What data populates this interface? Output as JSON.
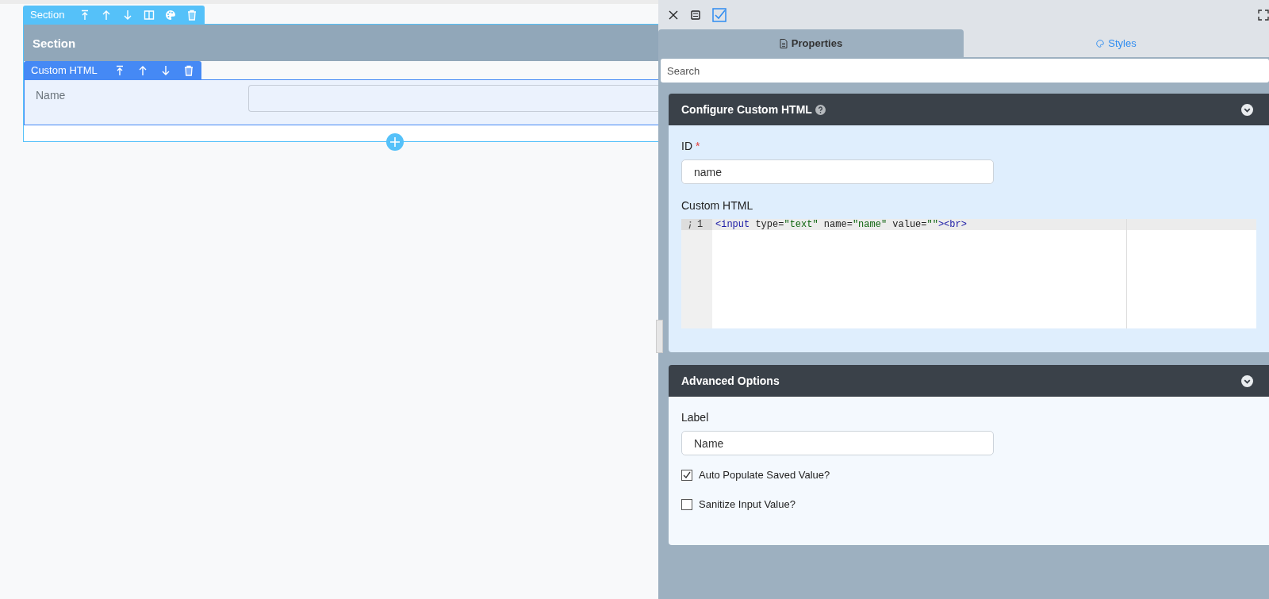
{
  "canvas": {
    "section_toolbar": {
      "label": "Section"
    },
    "section_title": "Section",
    "component_toolbar": {
      "label": "Custom HTML"
    },
    "field_label": "Name"
  },
  "panel": {
    "tabs": [
      {
        "label": "Properties",
        "kind": "file",
        "selected": true
      },
      {
        "label": "Styles",
        "kind": "palette",
        "selected": false
      }
    ],
    "search": {
      "placeholder": "Search"
    },
    "config_card": {
      "title": "Configure Custom HTML",
      "id_label": "ID",
      "required_mark": "*",
      "id_value": "name",
      "code_label": "Custom HTML",
      "code_lines": [
        {
          "number": "1",
          "tokens": [
            {
              "kind": "tag",
              "text": "<input"
            },
            {
              "kind": "attr",
              "text": " type"
            },
            {
              "kind": "plain",
              "text": "="
            },
            {
              "kind": "string",
              "text": "\"text\""
            },
            {
              "kind": "attr",
              "text": " name"
            },
            {
              "kind": "plain",
              "text": "="
            },
            {
              "kind": "string",
              "text": "\"name\""
            },
            {
              "kind": "attr",
              "text": " value"
            },
            {
              "kind": "plain",
              "text": "="
            },
            {
              "kind": "string",
              "text": "\"\""
            },
            {
              "kind": "tag",
              "text": "><br>"
            }
          ]
        }
      ]
    },
    "advanced_card": {
      "title": "Advanced Options",
      "label_label": "Label",
      "label_value": "Name",
      "options": [
        {
          "label": "Auto Populate Saved Value?",
          "checked": true
        },
        {
          "label": "Sanitize Input Value?",
          "checked": false
        }
      ]
    }
  }
}
